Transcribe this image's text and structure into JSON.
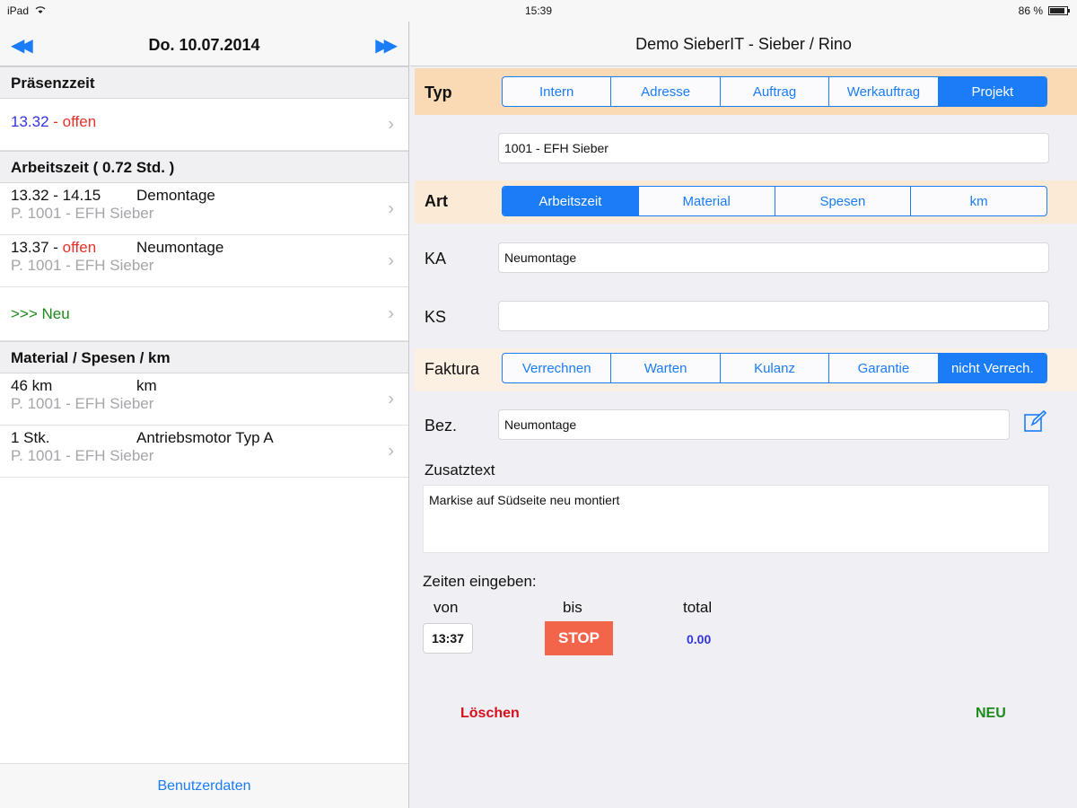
{
  "statusbar": {
    "device": "iPad",
    "time": "15:39",
    "battery": "86 %"
  },
  "left": {
    "date": "Do. 10.07.2014",
    "prev_icon": "double-arrow-left",
    "next_icon": "double-arrow-right",
    "presence": {
      "header": "Präsenzzeit",
      "time": "13.32",
      "separator": " - ",
      "status": "offen"
    },
    "worktime": {
      "header": "Arbeitszeit  ( 0.72 Std. )",
      "rows": [
        {
          "time": "13.32 - 14.15",
          "time_status": "",
          "desc": "Demontage",
          "project": "P. 1001 - EFH Sieber"
        },
        {
          "time": "13.37 - ",
          "time_status": "offen",
          "desc": "Neumontage",
          "project": "P. 1001 - EFH Sieber"
        }
      ],
      "new_label": ">>> Neu"
    },
    "material": {
      "header": "Material / Spesen / km",
      "rows": [
        {
          "qty": "46 km",
          "desc": "km",
          "project": "P. 1001 - EFH Sieber"
        },
        {
          "qty": "1 Stk.",
          "desc": "Antriebsmotor Typ A",
          "project": "P. 1001 - EFH Sieber"
        }
      ]
    },
    "footer": "Benutzerdaten"
  },
  "right": {
    "title": "Demo SieberIT   -   Sieber / Rino",
    "typ": {
      "label": "Typ",
      "options": [
        "Intern",
        "Adresse",
        "Auftrag",
        "Werkauftrag",
        "Projekt"
      ],
      "selected": "Projekt"
    },
    "project_field": "1001 - EFH Sieber",
    "art": {
      "label": "Art",
      "options": [
        "Arbeitszeit",
        "Material",
        "Spesen",
        "km"
      ],
      "selected": "Arbeitszeit"
    },
    "ka": {
      "label": "KA",
      "value": "Neumontage"
    },
    "ks": {
      "label": "KS",
      "value": ""
    },
    "faktura": {
      "label": "Faktura",
      "options": [
        "Verrechnen",
        "Warten",
        "Kulanz",
        "Garantie",
        "nicht Verrech."
      ],
      "selected": "nicht Verrech."
    },
    "bez": {
      "label": "Bez.",
      "value": "Neumontage"
    },
    "zusatz": {
      "label": "Zusatztext",
      "value": "Markise auf Südseite neu montiert"
    },
    "times": {
      "label": "Zeiten eingeben:",
      "von_label": "von",
      "bis_label": "bis",
      "total_label": "total",
      "von": "13:37",
      "stop": "STOP",
      "total": "0.00"
    },
    "delete_label": "Löschen",
    "new_label": "NEU"
  },
  "colors": {
    "accent": "#1a7cf6",
    "red": "#e8302a",
    "green": "#1b8a1b",
    "stop": "#f2654a",
    "typ_band": "#fad9b5"
  }
}
